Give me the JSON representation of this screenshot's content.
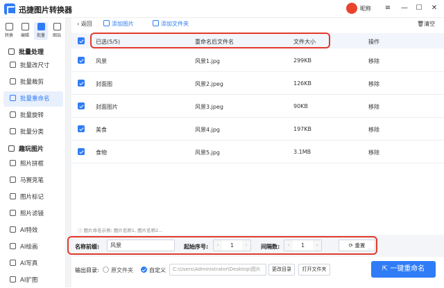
{
  "app": {
    "title": "迅捷图片转换器",
    "nickname": "昵称"
  },
  "window": {
    "menu": "≡",
    "minimize": "—",
    "maximize": "☐",
    "close": "✕"
  },
  "sidebar": {
    "top_tabs": [
      {
        "label": "转换",
        "active": false
      },
      {
        "label": "编辑",
        "active": false
      },
      {
        "label": "批量",
        "active": true
      },
      {
        "label": "图玩",
        "active": false
      }
    ],
    "sections": [
      {
        "title": "批量处理",
        "items": [
          "批量改尺寸",
          "批量裁剪",
          "批量重命名",
          "批量旋转",
          "批量分类"
        ]
      },
      {
        "title": "趣玩图片",
        "items": [
          "照片拼框",
          "马赛克笔",
          "图片标记",
          "照片滤镜",
          "AI特效",
          "AI绘画",
          "AI写真",
          "AI扩图"
        ]
      }
    ],
    "active_item": "批量重命名"
  },
  "toolbar": {
    "back": "返回",
    "add_image": "添加图片",
    "add_folder": "添加文件夹",
    "clear": "清空"
  },
  "table": {
    "headers": {
      "selected": "已选(5/5)",
      "new_name": "重命名后文件名",
      "size": "文件大小",
      "action": "操作"
    },
    "rows": [
      {
        "name": "风景",
        "new_name": "风景1.jpg",
        "size": "299KB",
        "action": "移除"
      },
      {
        "name": "封面图",
        "new_name": "风景2.jpeg",
        "size": "126KB",
        "action": "移除"
      },
      {
        "name": "封面图片",
        "new_name": "风景3.jpeg",
        "size": "90KB",
        "action": "移除"
      },
      {
        "name": "美食",
        "new_name": "风景4.jpg",
        "size": "197KB",
        "action": "移除"
      },
      {
        "name": "食物",
        "new_name": "风景5.jpg",
        "size": "3.1MB",
        "action": "移除"
      }
    ]
  },
  "rename": {
    "hint": "图片命名示例: 图片名称1, 图片名称2...",
    "prefix_label": "名称前缀:",
    "prefix_value": "风景",
    "start_label": "起始序号:",
    "start_value": "1",
    "interval_label": "间隔数:",
    "interval_value": "1",
    "reset": "重置"
  },
  "output": {
    "label": "输出目录:",
    "opt_original": "原文件夹",
    "opt_custom": "自定义",
    "path": "C:\\Users\\Administrator\\Desktop\\图片",
    "change": "更改目录",
    "open": "打开文件夹",
    "start": "一键重命名"
  },
  "colors": {
    "accent": "#2f7cf6",
    "highlight": "#e2392b"
  }
}
